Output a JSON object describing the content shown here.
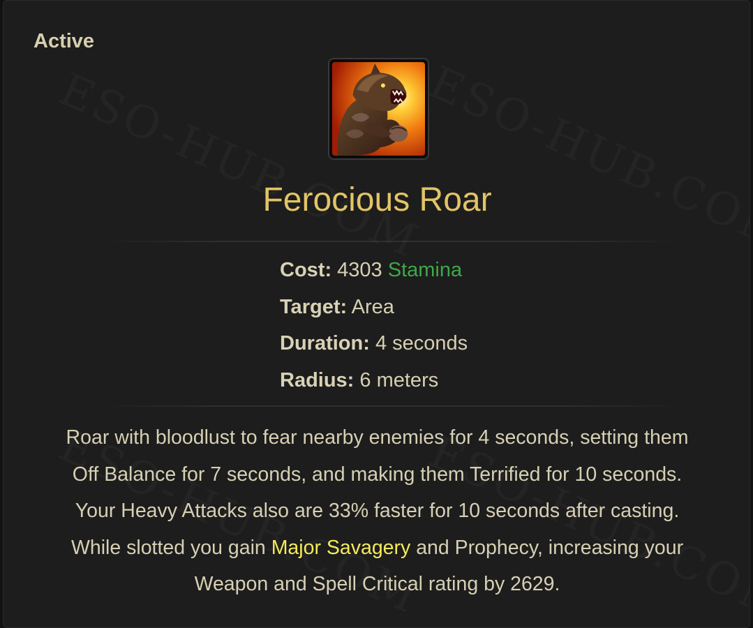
{
  "skill": {
    "label": "Active",
    "name": "Ferocious Roar",
    "icon": "werewolf-roar-icon",
    "stats": [
      {
        "key": "Cost:",
        "value": "4303",
        "resource": "Stamina"
      },
      {
        "key": "Target:",
        "value": "Area"
      },
      {
        "key": "Duration:",
        "value": "4 seconds"
      },
      {
        "key": "Radius:",
        "value": "6 meters"
      }
    ],
    "description": {
      "line1": "Roar with bloodlust to fear nearby enemies for 4 seconds, setting them",
      "line2": "Off Balance for 7 seconds, and making them Terrified for 10 seconds.",
      "line3": "Your Heavy Attacks also are 33% faster for 10 seconds after casting.",
      "line4_before": "While slotted you gain ",
      "line4_highlight": "Major Savagery",
      "line4_after": " and Prophecy, increasing your",
      "line5": "Weapon and Spell Critical rating by 2629."
    }
  },
  "watermark": "ESO-HUB.COM",
  "colors": {
    "background": "#1d1d1d",
    "title": "#e2c466",
    "text": "#d6d0b4",
    "stamina": "#3ea84a",
    "highlight": "#f4ea5a"
  }
}
